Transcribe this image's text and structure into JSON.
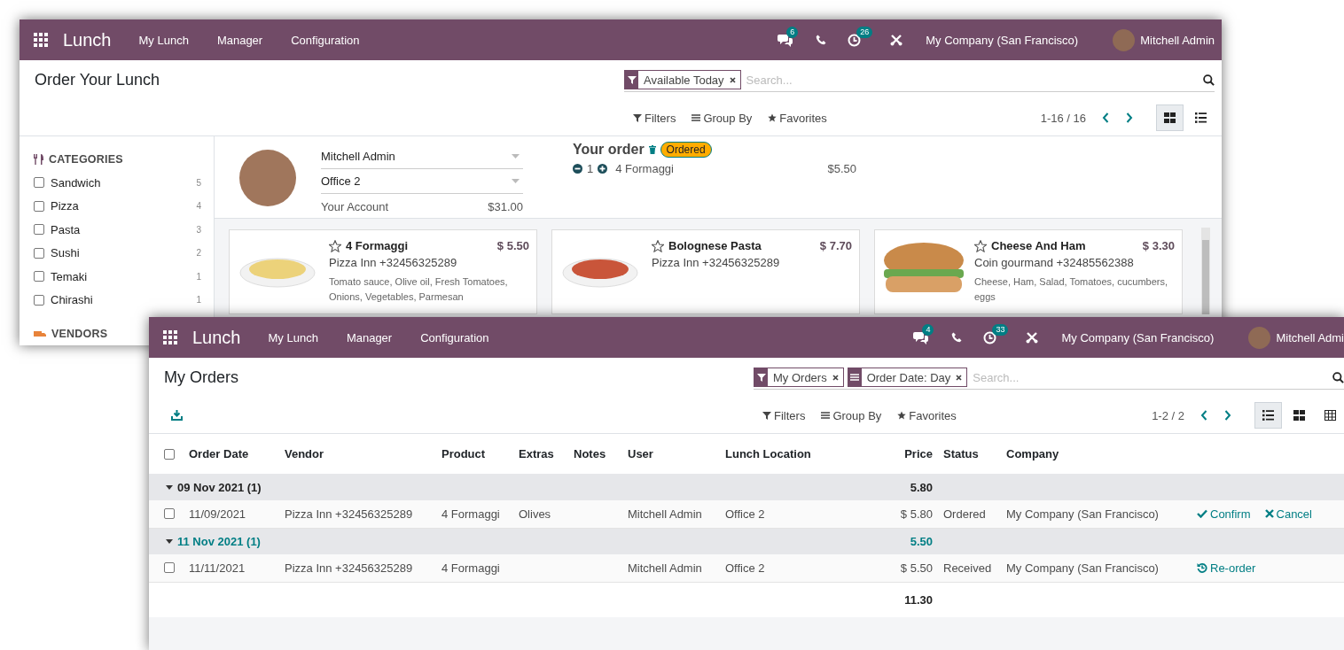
{
  "order_window": {
    "navbar": {
      "app_name": "Lunch",
      "menu": [
        {
          "label": "My Lunch"
        },
        {
          "label": "Manager"
        },
        {
          "label": "Configuration"
        }
      ],
      "messages_badge": "6",
      "activities_badge": "26",
      "company": "My Company (San Francisco)",
      "user": "Mitchell Admin"
    },
    "control_panel": {
      "title": "Order Your Lunch",
      "search": {
        "facets": [
          {
            "kind": "filter",
            "label": "Available Today"
          }
        ],
        "placeholder": "Search..."
      },
      "search_options": [
        {
          "kind": "filters",
          "label": "Filters"
        },
        {
          "kind": "group_by",
          "label": "Group By"
        },
        {
          "kind": "favorites",
          "label": "Favorites"
        }
      ],
      "pager": "1-16 / 16",
      "views": [
        {
          "kind": "kanban",
          "selected": true
        },
        {
          "kind": "list",
          "selected": false
        }
      ]
    },
    "sidebar": {
      "sections": [
        {
          "kind": "categories",
          "heading": "CATEGORIES",
          "items": [
            {
              "label": "Sandwich",
              "count": "5",
              "checked": false
            },
            {
              "label": "Pizza",
              "count": "4",
              "checked": false
            },
            {
              "label": "Pasta",
              "count": "3",
              "checked": false
            },
            {
              "label": "Sushi",
              "count": "2",
              "checked": false
            },
            {
              "label": "Temaki",
              "count": "1",
              "checked": false
            },
            {
              "label": "Chirashi",
              "count": "1",
              "checked": false
            }
          ]
        },
        {
          "kind": "vendors",
          "heading": "VENDORS"
        }
      ]
    },
    "user_panel": {
      "user": "Mitchell Admin",
      "location": "Office 2",
      "account_label": "Your Account",
      "account": "$31.00"
    },
    "order": {
      "title": "Your order",
      "status": "Ordered",
      "lines": [
        {
          "quantity": "1",
          "product": "4 Formaggi",
          "price": "$5.50"
        }
      ]
    },
    "products": [
      {
        "name": "4 Formaggi",
        "price": "$ 5.50",
        "vendor": "Pizza Inn +32456325289",
        "description": "Tomato sauce, Olive oil, Fresh Tomatoes, Onions, Vegetables, Parmesan",
        "favorite": false,
        "kind": "pasta"
      },
      {
        "name": "Bolognese Pasta",
        "price": "$ 7.70",
        "vendor": "Pizza Inn +32456325289",
        "favorite": false,
        "kind": "pasta"
      },
      {
        "name": "Cheese And Ham",
        "price": "$ 3.30",
        "vendor": "Coin gourmand +32485562388",
        "description": "Cheese, Ham, Salad, Tomatoes, cucumbers, eggs",
        "favorite": false,
        "kind": "sandwich"
      }
    ]
  },
  "orders_window": {
    "navbar": {
      "app_name": "Lunch",
      "menu": [
        {
          "label": "My Lunch"
        },
        {
          "label": "Manager"
        },
        {
          "label": "Configuration"
        }
      ],
      "messages_badge": "4",
      "activities_badge": "33",
      "company": "My Company (San Francisco)",
      "user": "Mitchell Admi"
    },
    "control_panel": {
      "title": "My Orders",
      "search": {
        "facets": [
          {
            "kind": "filter",
            "label": "My Orders"
          },
          {
            "kind": "group",
            "label": "Order Date: Day"
          }
        ],
        "placeholder": "Search..."
      },
      "search_options": [
        {
          "kind": "filters",
          "label": "Filters"
        },
        {
          "kind": "group_by",
          "label": "Group By"
        },
        {
          "kind": "favorites",
          "label": "Favorites"
        }
      ],
      "pager": "1-2 / 2",
      "views": [
        {
          "kind": "list",
          "selected": true
        },
        {
          "kind": "kanban",
          "selected": false
        },
        {
          "kind": "pivot",
          "selected": false
        }
      ]
    },
    "table": {
      "all_checked": false,
      "columns": [
        "Order Date",
        "Vendor",
        "Product",
        "Extras",
        "Notes",
        "User",
        "Lunch Location",
        "Price",
        "Status",
        "Company"
      ],
      "groups": [
        {
          "label": "09 Nov 2021 (1)",
          "total": "5.80",
          "expanded": true,
          "highlighted": false,
          "rows": [
            {
              "checked": false,
              "cells": [
                "11/09/2021",
                "Pizza Inn +32456325289",
                "4 Formaggi",
                "Olives",
                null,
                "Mitchell Admin",
                "Office 2",
                "$ 5.80",
                "Ordered",
                "My Company (San Francisco)"
              ],
              "actions": [
                {
                  "kind": "confirm",
                  "label": "Confirm"
                },
                {
                  "kind": "cancel",
                  "label": "Cancel"
                }
              ]
            }
          ]
        },
        {
          "label": "11 Nov 2021 (1)",
          "total": "5.50",
          "expanded": true,
          "highlighted": true,
          "rows": [
            {
              "checked": false,
              "cells": [
                "11/11/2021",
                "Pizza Inn +32456325289",
                "4 Formaggi",
                null,
                null,
                "Mitchell Admin",
                "Office 2",
                "$ 5.50",
                "Received",
                "My Company (San Francisco)"
              ],
              "actions": [
                {
                  "kind": "reorder",
                  "label": "Re-order"
                }
              ]
            }
          ]
        }
      ],
      "total": "11.30"
    }
  }
}
